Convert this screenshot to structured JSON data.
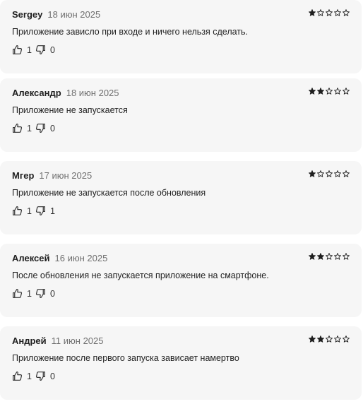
{
  "reviews": [
    {
      "author": "Sergey",
      "date": "18 июн 2025",
      "rating": 1,
      "text": "Приложение зависло при входе и ничего нельзя сделать.",
      "likes": "1",
      "dislikes": "0"
    },
    {
      "author": "Александр",
      "date": "18 июн 2025",
      "rating": 2,
      "text": "Приложение не запускается",
      "likes": "1",
      "dislikes": "0"
    },
    {
      "author": "Мгер",
      "date": "17 июн 2025",
      "rating": 1,
      "text": "Приложение не запускается после обновления",
      "likes": "1",
      "dislikes": "1"
    },
    {
      "author": "Алексей",
      "date": "16 июн 2025",
      "rating": 2,
      "text": "После обновления не запускается приложение на смартфоне.",
      "likes": "1",
      "dislikes": "0"
    },
    {
      "author": "Андрей",
      "date": "11 июн 2025",
      "rating": 2,
      "text": "Приложение после первого запуска зависает намертво",
      "likes": "1",
      "dislikes": "0"
    }
  ],
  "rating_max": 5,
  "colors": {
    "card_bg": "#f6f6f6",
    "star": "#1f1f1f",
    "muted": "#6f6f6f"
  },
  "icons": {
    "like": "thumbs-up-icon",
    "dislike": "thumbs-down-icon",
    "star_filled": "star-filled-icon",
    "star_empty": "star-outline-icon"
  }
}
